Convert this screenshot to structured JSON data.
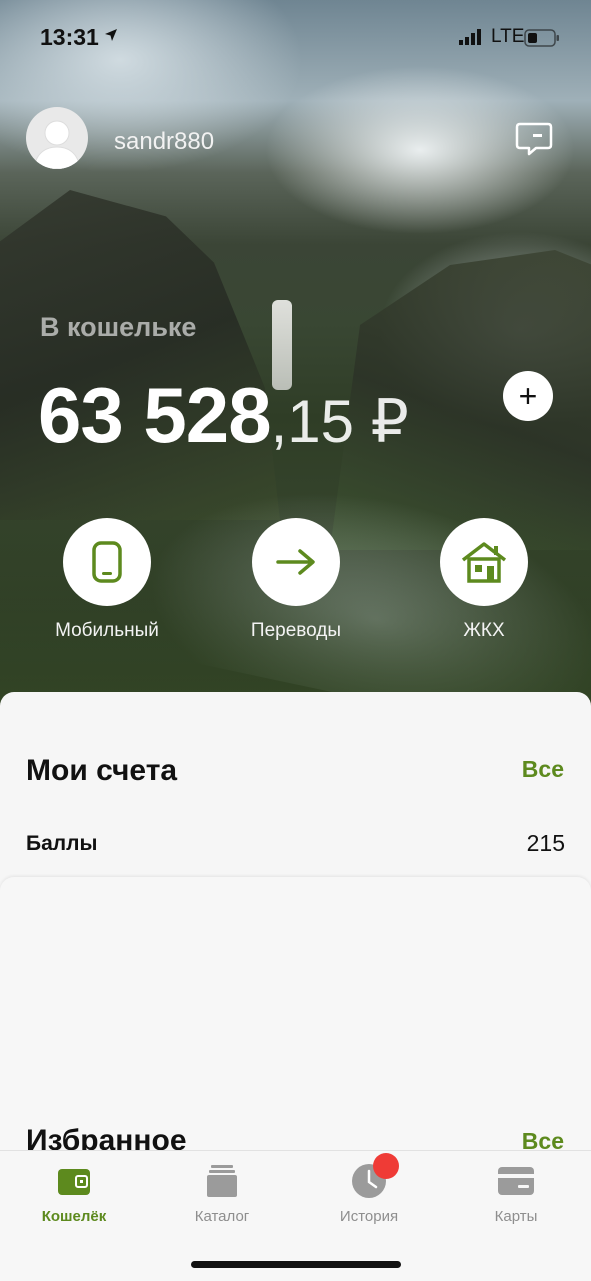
{
  "status_bar": {
    "time": "13:31",
    "carrier": "LTE",
    "location_icon": "location-arrow-icon",
    "signal_icon": "cellular-signal-icon",
    "battery_icon": "battery-icon"
  },
  "profile": {
    "username": "sandr880",
    "avatar_icon": "user-avatar-icon",
    "chat_icon": "chat-bubble-icon"
  },
  "wallet": {
    "label": "В кошельке",
    "balance_integer": "63 528",
    "balance_fraction": ",15 ₽",
    "add_label": "+"
  },
  "quick_actions": [
    {
      "label": "Мобильный",
      "icon": "mobile-phone-icon"
    },
    {
      "label": "Переводы",
      "icon": "arrow-right-icon"
    },
    {
      "label": "ЖКХ",
      "icon": "house-icon"
    }
  ],
  "accounts": {
    "title": "Мои счета",
    "all_label": "Все",
    "rows": [
      {
        "name": "Баллы",
        "value": "215"
      }
    ]
  },
  "favorites": {
    "title": "Избранное",
    "all_label": "Все"
  },
  "tabbar": {
    "items": [
      {
        "label": "Кошелёк",
        "icon": "wallet-icon",
        "active": true
      },
      {
        "label": "Каталог",
        "icon": "catalog-icon",
        "active": false
      },
      {
        "label": "История",
        "icon": "clock-icon",
        "active": false
      },
      {
        "label": "Карты",
        "icon": "card-icon",
        "active": false
      }
    ]
  },
  "colors": {
    "accent": "#5d8a1e",
    "badge": "#ef3b36",
    "card_bg": "#f6f6f6"
  }
}
